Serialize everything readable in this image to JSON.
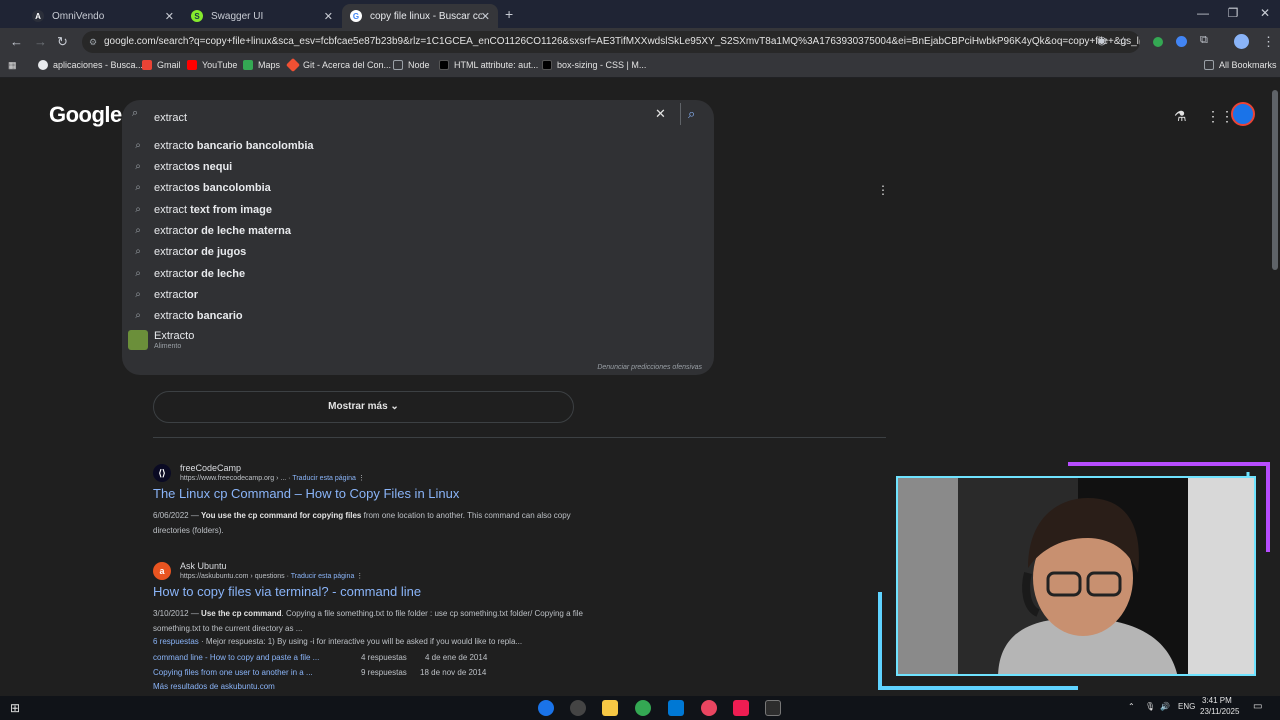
{
  "tabs": [
    {
      "title": "OmniVendo",
      "icon": "omnivendo-favicon"
    },
    {
      "title": "Swagger UI",
      "icon": "swagger-favicon"
    },
    {
      "title": "copy file linux - Buscar con Go...",
      "icon": "google-favicon"
    }
  ],
  "address_bar": {
    "url": "google.com/search?q=copy+file+linux&sca_esv=fcbfcae5e87b23b9&rlz=1C1GCEA_enCO1126CO1126&sxsrf=AE3TifMXXwdslSkLe95XY_S2SXmvT8a1MQ%3A1763930375004&ei=BnEjabCBPciHwbkP96K4yQk&oq=copy+file+&gs_lp=Egxn..."
  },
  "bookmarks": [
    {
      "label": "aplicaciones - Busca...",
      "color": "#e8eaed"
    },
    {
      "label": "Gmail",
      "color": "#ea4335"
    },
    {
      "label": "YouTube",
      "color": "#ff0000"
    },
    {
      "label": "Maps",
      "color": "#34a853"
    },
    {
      "label": "Git - Acerca del Con...",
      "color": "#f05033"
    },
    {
      "label": "Node",
      "color": "#9aa0a6"
    },
    {
      "label": "HTML attribute: aut...",
      "color": "#111111"
    },
    {
      "label": "box-sizing - CSS | M...",
      "color": "#111111"
    }
  ],
  "all_bookmarks": "All Bookmarks",
  "logo": "Google",
  "search": {
    "value": "extract",
    "suggestions": [
      {
        "prefix": "extract",
        "rest": "o bancario bancolombia"
      },
      {
        "prefix": "extract",
        "rest": "os nequi"
      },
      {
        "prefix": "extract",
        "rest": "os bancolombia"
      },
      {
        "prefix": "extract",
        "rest": " text from image"
      },
      {
        "prefix": "extract",
        "rest": "or de leche materna"
      },
      {
        "prefix": "extract",
        "rest": "or de jugos"
      },
      {
        "prefix": "extract",
        "rest": "or de leche"
      },
      {
        "prefix": "extract",
        "rest": "or"
      },
      {
        "prefix": "extract",
        "rest": "o bancario"
      }
    ],
    "entity": {
      "title": "Extracto",
      "subtitle": "Alimento"
    },
    "report": "Denunciar predicciones ofensivas"
  },
  "mostrar_mas": "Mostrar más",
  "results": [
    {
      "site": "freeCodeCamp",
      "url": "https://www.freecodecamp.org › ...",
      "translate": "Traducir esta página",
      "title": "The Linux cp Command – How to Copy Files in Linux",
      "date": "6/06/2022 — ",
      "snippet_bold": "You use the cp command for copying files",
      "snippet": " from one location to another. This command can also copy directories (folders)."
    },
    {
      "site": "Ask Ubuntu",
      "url": "https://askubuntu.com › questions",
      "translate": "Traducir esta página",
      "title": "How to copy files via terminal? - command line",
      "date": "3/10/2012 — ",
      "snippet_bold": "Use the cp command",
      "snippet": ". Copying a file something.txt to file folder : use cp something.txt folder/ Copying a file something.txt to the current directory as ...",
      "answers": "6 respuestas",
      "best": " · Mejor respuesta: 1) By using -i for interactive you will be asked if you would like to repla...",
      "subs": [
        {
          "title": "command line - How to copy and paste a file ...",
          "answers": "4 respuestas",
          "date": "4 de ene de 2014"
        },
        {
          "title": "Copying files from one user to another in a ...",
          "answers": "9 respuestas",
          "date": "18 de nov de 2014"
        }
      ],
      "more": "Más resultados de askubuntu.com"
    }
  ],
  "tray": {
    "lang": "ENG",
    "time": "3:41 PM",
    "date": "23/11/2025"
  }
}
